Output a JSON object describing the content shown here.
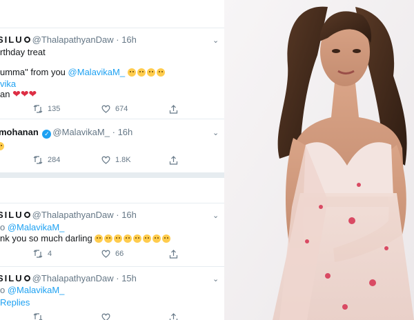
{
  "tweets": [
    {
      "name": "SILU",
      "handle": "@ThalapathyanDaw",
      "time": "16h",
      "lines": [
        "rthday treat",
        "umma\" from you",
        "@MalavikaM_",
        "vika",
        "an"
      ],
      "replies": "",
      "retweets": "135",
      "likes": "674"
    },
    {
      "name": "mohanan",
      "handle": "@MalavikaM_",
      "time": "16h",
      "retweets": "284",
      "likes": "1.8K"
    },
    {
      "name": "SILU",
      "handle": "@ThalapathyanDaw",
      "time": "16h",
      "lines": [
        "o",
        "@MalavikaM_",
        "nk you so much darling"
      ],
      "retweets": "4",
      "likes": "66"
    },
    {
      "name": "SILU",
      "handle": "@ThalapathyanDaw",
      "time": "15h",
      "lines": [
        "o",
        "@MalavikaM_",
        "Replies"
      ]
    }
  ],
  "separator": "·",
  "colors": {
    "link": "#1da1f2",
    "muted": "#657786",
    "divider": "#e6ecf0",
    "heart": "#dd2e44"
  },
  "photo_description": "woman in pink embroidered saree"
}
